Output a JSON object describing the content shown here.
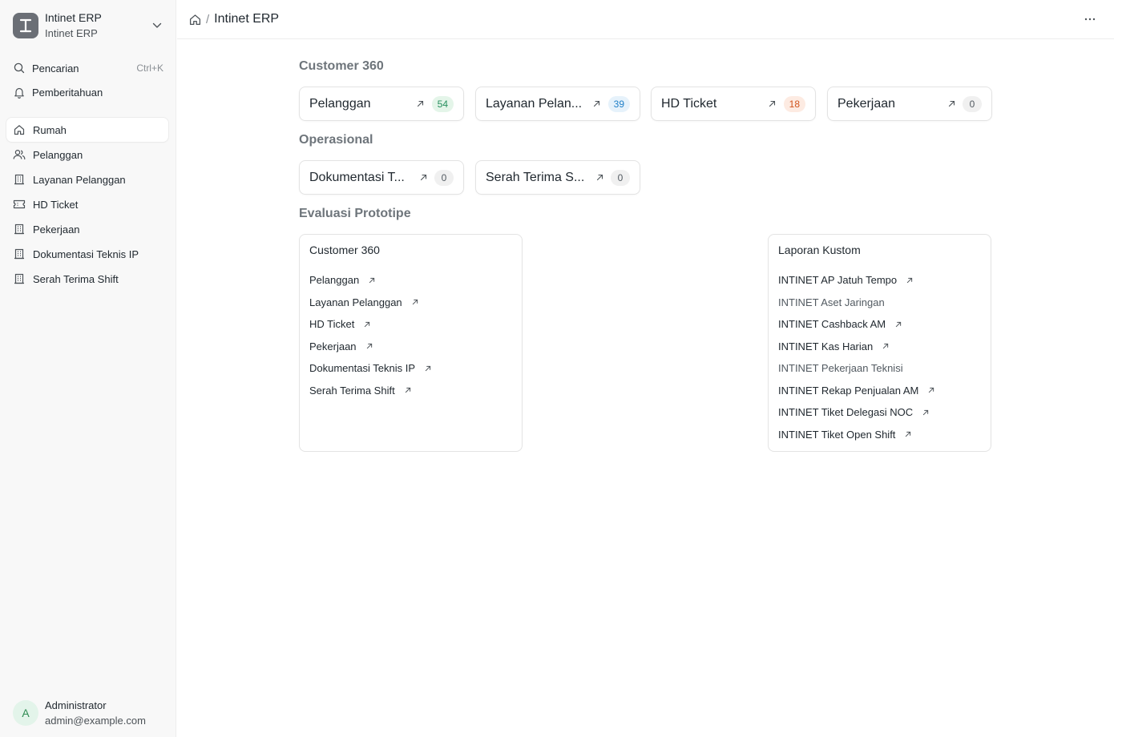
{
  "brand": {
    "title": "Intinet ERP",
    "subtitle": "Intinet ERP",
    "logo_letter": "I",
    "icons": {
      "logo": "brand-logo-icon",
      "chevron": "chevron-down-icon"
    }
  },
  "sidebar": {
    "search": {
      "label": "Pencarian",
      "shortcut": "Ctrl+K",
      "icon": "search-icon"
    },
    "notifications": {
      "label": "Pemberitahuan",
      "icon": "bell-icon"
    },
    "items": [
      {
        "label": "Rumah",
        "icon": "home-icon",
        "active": true
      },
      {
        "label": "Pelanggan",
        "icon": "users-icon"
      },
      {
        "label": "Layanan Pelanggan",
        "icon": "building-icon"
      },
      {
        "label": "HD Ticket",
        "icon": "ticket-icon"
      },
      {
        "label": "Pekerjaan",
        "icon": "building-icon"
      },
      {
        "label": "Dokumentasi Teknis IP",
        "icon": "building-icon"
      },
      {
        "label": "Serah Terima Shift",
        "icon": "building-icon"
      }
    ]
  },
  "user": {
    "initial": "A",
    "name": "Administrator",
    "email": "admin@example.com"
  },
  "header": {
    "title": "Intinet ERP",
    "separator": "/",
    "icons": {
      "home": "home-icon",
      "more": "more-horizontal-icon"
    }
  },
  "sections": {
    "customer360": {
      "title": "Customer 360",
      "shortcuts": [
        {
          "label": "Pelanggan",
          "count": "54",
          "color": "green"
        },
        {
          "label": "Layanan Pelan...",
          "count": "39",
          "color": "blue"
        },
        {
          "label": "HD Ticket",
          "count": "18",
          "color": "orange"
        },
        {
          "label": "Pekerjaan",
          "count": "0",
          "color": "gray"
        }
      ]
    },
    "operasional": {
      "title": "Operasional",
      "shortcuts": [
        {
          "label": "Dokumentasi T...",
          "count": "0",
          "color": "gray"
        },
        {
          "label": "Serah Terima S...",
          "count": "0",
          "color": "gray"
        }
      ]
    },
    "evaluasi": {
      "title": "Evaluasi Prototipe"
    }
  },
  "cards": [
    {
      "title": "Customer 360",
      "links": [
        {
          "label": "Pelanggan",
          "arrow": true
        },
        {
          "label": "Layanan Pelanggan",
          "arrow": true
        },
        {
          "label": "HD Ticket",
          "arrow": true
        },
        {
          "label": "Pekerjaan",
          "arrow": true
        },
        {
          "label": "Dokumentasi Teknis IP",
          "arrow": true
        },
        {
          "label": "Serah Terima Shift",
          "arrow": true
        }
      ]
    },
    {
      "title": "Laporan Kustom",
      "links": [
        {
          "label": "INTINET AP Jatuh Tempo",
          "arrow": true
        },
        {
          "label": "INTINET Aset Jaringan",
          "arrow": false
        },
        {
          "label": "INTINET Cashback AM",
          "arrow": true
        },
        {
          "label": "INTINET Kas Harian",
          "arrow": true
        },
        {
          "label": "INTINET Pekerjaan Teknisi",
          "arrow": false
        },
        {
          "label": "INTINET Rekap Penjualan AM",
          "arrow": true
        },
        {
          "label": "INTINET Tiket Delegasi NOC",
          "arrow": true
        },
        {
          "label": "INTINET Tiket Open Shift",
          "arrow": true
        }
      ]
    }
  ],
  "colors": {
    "badge_green_bg": "#e4f5e9",
    "badge_green_fg": "#278f5e",
    "badge_blue_bg": "#e6f2fb",
    "badge_blue_fg": "#1f7fc8",
    "badge_orange_bg": "#fdebe2",
    "badge_orange_fg": "#d1541e",
    "badge_gray_bg": "#f0f0f0",
    "badge_gray_fg": "#525a61"
  }
}
